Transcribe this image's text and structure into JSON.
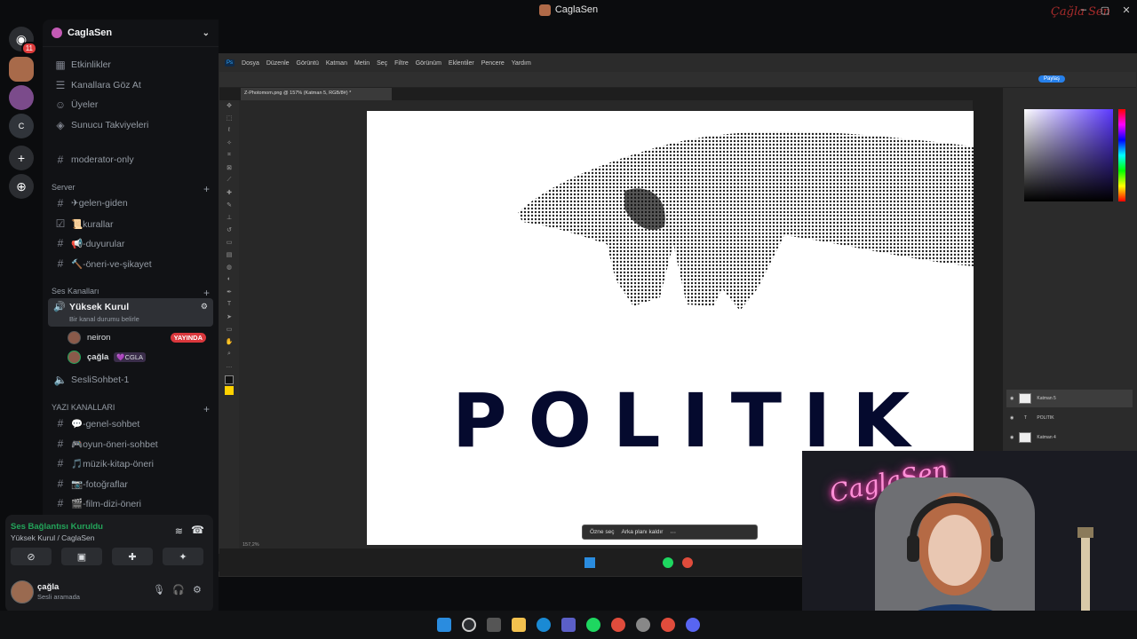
{
  "window": {
    "title": "CaglaSen",
    "min": "–",
    "max": "▢",
    "close": "✕",
    "brand": "Çağla Sen"
  },
  "rail": {
    "home_badge": "11",
    "servers": [
      "",
      "",
      "C",
      ""
    ],
    "add_icon": "+",
    "discover_icon": "⊕"
  },
  "server": {
    "name": "CaglaSen",
    "chevron": "⌄"
  },
  "top_links": [
    {
      "label": "Etkinlikler",
      "icon": "calendar-icon"
    },
    {
      "label": "Kanallara Göz At",
      "icon": "browse-icon"
    },
    {
      "label": "Üyeler",
      "icon": "members-icon"
    },
    {
      "label": "Sunucu Takviyeleri",
      "icon": "boost-icon"
    }
  ],
  "moderator_channel": "moderator-only",
  "category_server": "Server",
  "server_channels": [
    "✈gelen-giden",
    "📜kurallar",
    "📢-duyurular",
    "🔨-öneri-ve-şikayet"
  ],
  "category_voice": "Ses Kanalları",
  "voice_active": {
    "name": "Yüksek Kurul",
    "status": "Bir kanal durumu belirle"
  },
  "voice_users": [
    {
      "name": "neiron",
      "badge": "YAYINDA"
    },
    {
      "name": "çağla",
      "tag": "💜CGLA"
    }
  ],
  "voice_other": "SesliSohbet-1",
  "category_text": "YAZI KANALLARI",
  "text_channels": [
    "💬-genel-sohbet",
    "🎮oyun-öneri-sohbet",
    "🎵müzik-kitap-öneri",
    "📷-fotoğraflar",
    "🎬-film-dizi-öneri"
  ],
  "voice_panel": {
    "status": "Ses Bağlantısı Kuruldu",
    "sub": "Yüksek Kurul / CaglaSen"
  },
  "user": {
    "name": "çağla",
    "status": "Sesli aramada"
  },
  "photoshop": {
    "menu": [
      "Dosya",
      "Düzenle",
      "Görüntü",
      "Katman",
      "Metin",
      "Seç",
      "Filtre",
      "Görünüm",
      "Eklentiler",
      "Pencere",
      "Yardım"
    ],
    "tab": "Z-Photomom.png @ 157% (Katman 5, RGB/8#) *",
    "canvas_text": "POLITIK",
    "context_bar": [
      "Özne seç",
      "Arka planı kaldır"
    ],
    "zoom": "157,2%",
    "layers": [
      "Katman 5",
      "POLITIK",
      "Katman 4"
    ],
    "share": "Paylaş"
  },
  "webcam": {
    "neon": "CaglaSen"
  }
}
